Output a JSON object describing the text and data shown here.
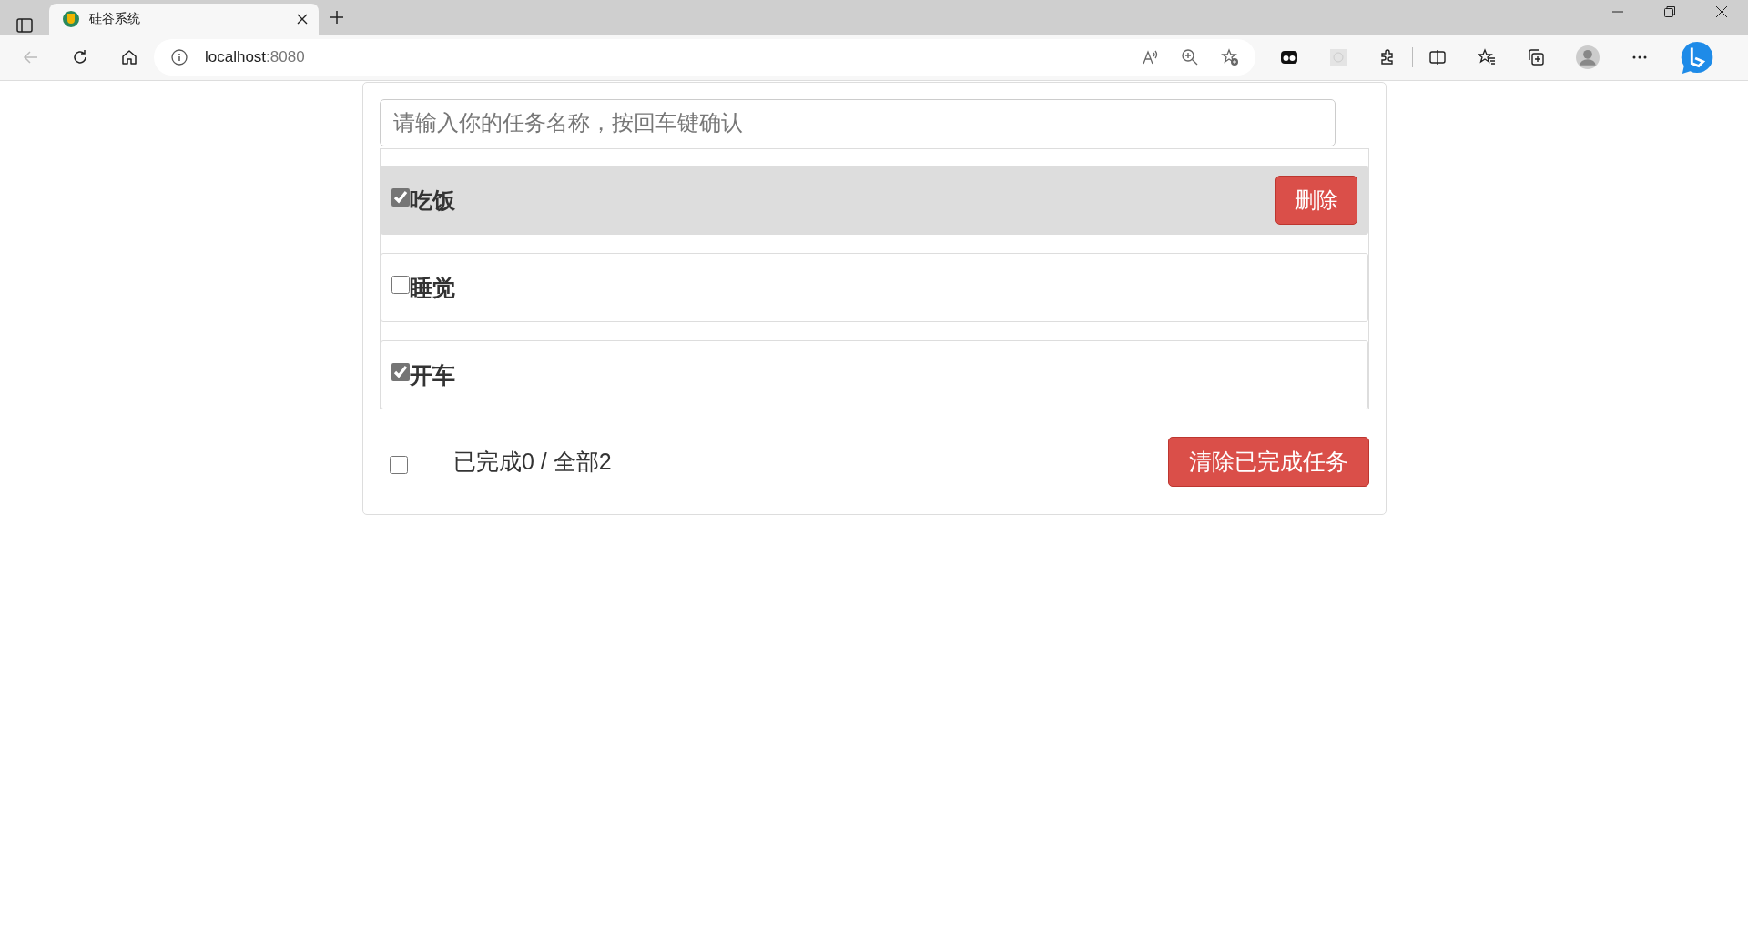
{
  "browser": {
    "tab_title": "硅谷系统",
    "url_host": "localhost",
    "url_port": ":8080"
  },
  "todo": {
    "input": {
      "placeholder": "请输入你的任务名称，按回车键确认"
    },
    "items": [
      {
        "title": "吃饭",
        "done": true,
        "hovered": true
      },
      {
        "title": "睡觉",
        "done": false,
        "hovered": false
      },
      {
        "title": "开车",
        "done": true,
        "hovered": false
      }
    ],
    "delete_label": "删除",
    "footer": {
      "all_checked": false,
      "summary": "已完成0 / 全部2",
      "clear_label": "清除已完成任务"
    }
  }
}
